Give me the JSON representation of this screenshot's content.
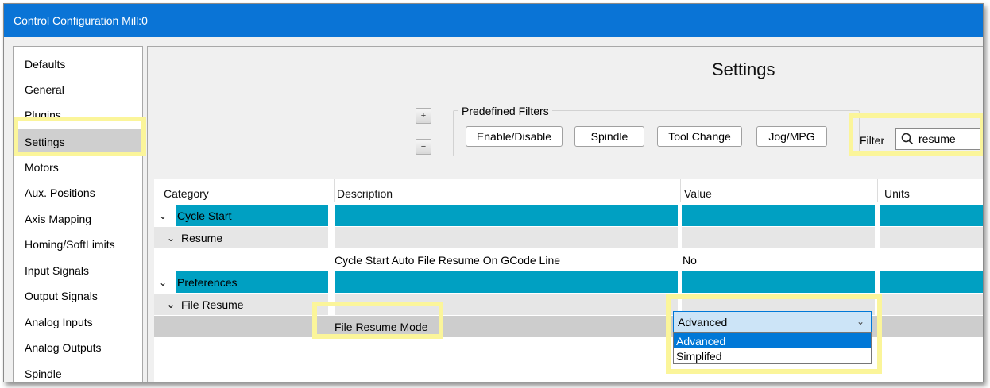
{
  "window": {
    "title": "Control Configuration Mill:0"
  },
  "nav": {
    "items": [
      {
        "label": "Defaults"
      },
      {
        "label": "General"
      },
      {
        "label": "Plugins"
      },
      {
        "label": "Settings"
      },
      {
        "label": "Motors"
      },
      {
        "label": "Aux. Positions"
      },
      {
        "label": "Axis Mapping"
      },
      {
        "label": "Homing/SoftLimits"
      },
      {
        "label": "Input Signals"
      },
      {
        "label": "Output Signals"
      },
      {
        "label": "Analog Inputs"
      },
      {
        "label": "Analog Outputs"
      },
      {
        "label": "Spindle"
      }
    ],
    "selected": "Settings"
  },
  "panel": {
    "title": "Settings",
    "expand_glyph": "+",
    "collapse_glyph": "−",
    "predefined_filters": {
      "legend": "Predefined Filters",
      "buttons": [
        "Enable/Disable",
        "Spindle",
        "Tool Change",
        "Jog/MPG"
      ]
    },
    "filter": {
      "label": "Filter",
      "value": "resume"
    }
  },
  "table": {
    "headers": [
      "Category",
      "Description",
      "Value",
      "Units"
    ],
    "rows": [
      {
        "category": "Cycle Start",
        "level": 0,
        "description": "",
        "value": ""
      },
      {
        "category": "Resume",
        "level": 1,
        "description": "",
        "value": ""
      },
      {
        "category": "",
        "level": 2,
        "description": "Cycle Start Auto File Resume On GCode Line",
        "value": "No"
      },
      {
        "category": "Preferences",
        "level": 0,
        "description": "",
        "value": ""
      },
      {
        "category": "File Resume",
        "level": 1,
        "description": "",
        "value": ""
      },
      {
        "category": "",
        "level": 2,
        "description": "File Resume Mode",
        "value": "Advanced"
      }
    ]
  },
  "dropdown": {
    "selected": "Advanced",
    "options": [
      "Advanced",
      "Simplifed"
    ]
  },
  "colors": {
    "title_bar": "#0a74d6",
    "category_row": "#00a0c2",
    "highlight": "#fbf59a",
    "selection": "#0078d7"
  },
  "icons": {
    "chevron": "chevron-down-icon",
    "search": "search-icon",
    "expand": "expand-tree-icon",
    "collapse": "collapse-tree-icon"
  }
}
